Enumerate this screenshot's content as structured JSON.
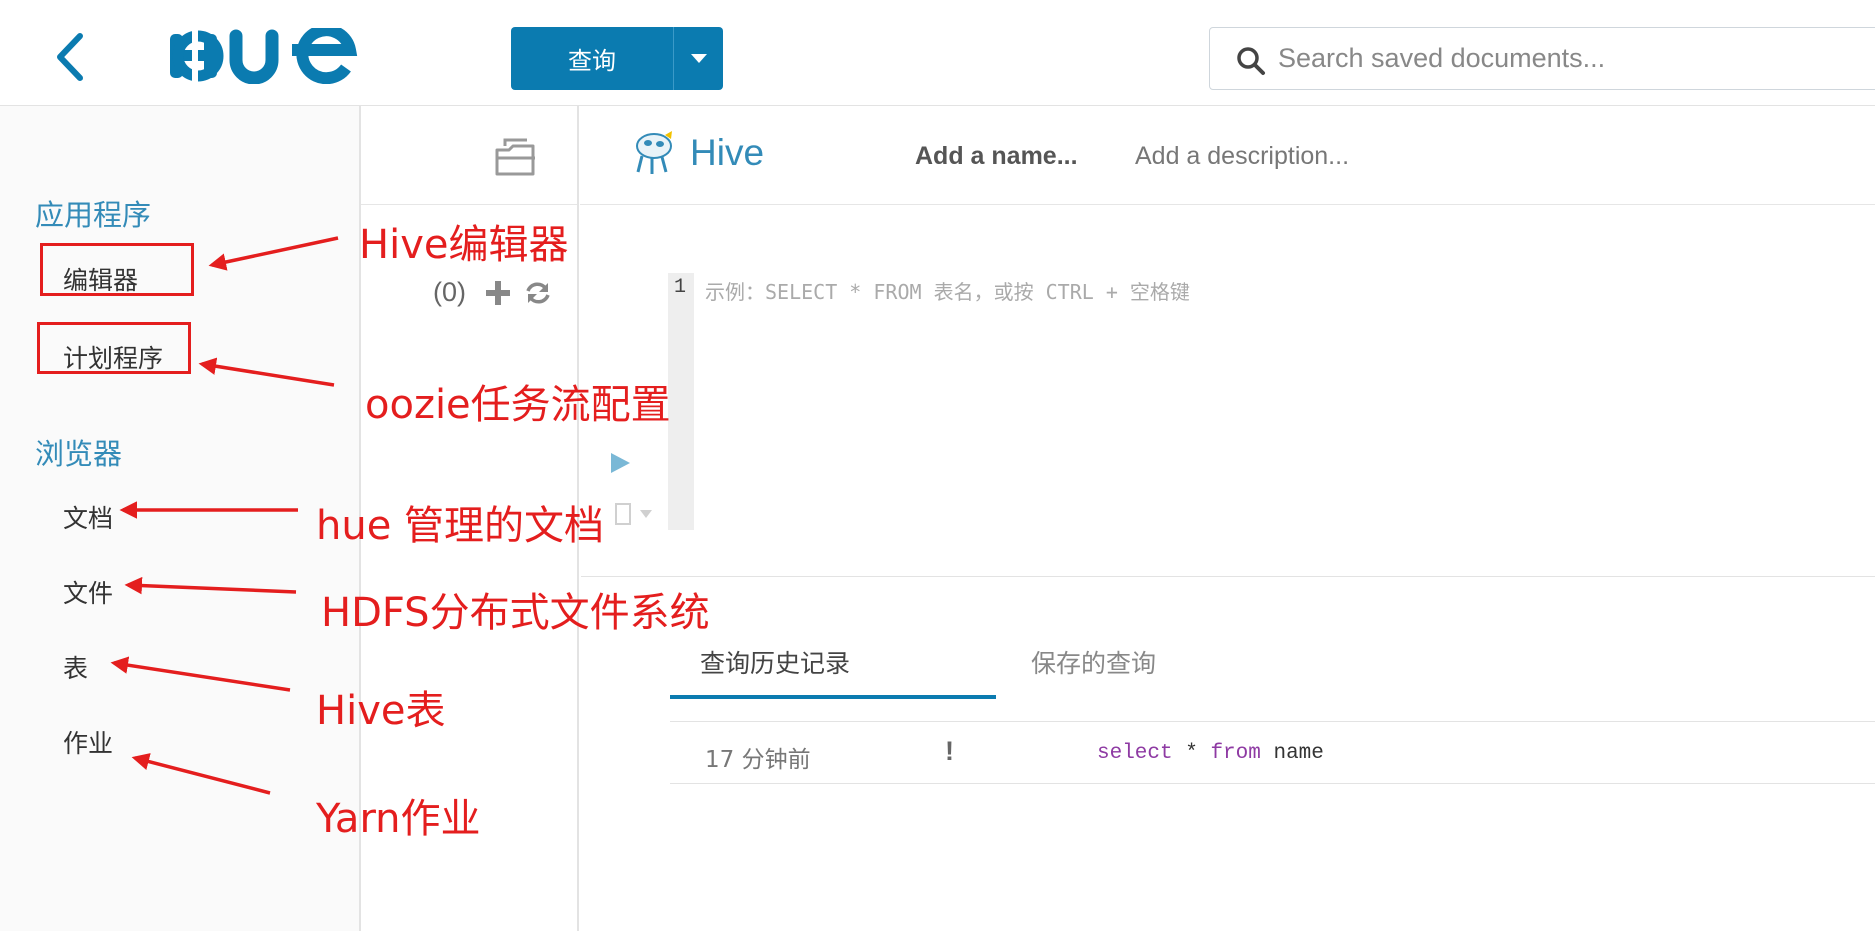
{
  "header": {
    "query_button_label": "查询",
    "search_placeholder": "Search saved documents..."
  },
  "sidebar": {
    "apps_title": "应用程序",
    "apps_items": [
      "编辑器",
      "计划程序"
    ],
    "browsers_title": "浏览器",
    "browser_items": [
      "文档",
      "文件",
      "表",
      "作业"
    ]
  },
  "assist_panel": {
    "count": "(0)"
  },
  "editor": {
    "type_title": "Hive",
    "add_name": "Add a name...",
    "add_description": "Add a description...",
    "line_number": "1",
    "placeholder": "示例：SELECT * FROM 表名，或按 CTRL + 空格键"
  },
  "results": {
    "tabs": [
      "查询历史记录",
      "保存的查询"
    ],
    "history": [
      {
        "time": "17 分钟前",
        "status": "!",
        "kw1": "select",
        "mid": " * ",
        "kw2": "from",
        "rest": " name"
      }
    ]
  },
  "annotations": [
    "Hive编辑器",
    "oozie任务流配置",
    "hue 管理的文档",
    "HDFS分布式文件系统",
    "Hive表",
    "Yarn作业"
  ],
  "colors": {
    "accent": "#0b7bb0",
    "link_blue": "#338bb8",
    "annotation_red": "#e41e1e"
  }
}
